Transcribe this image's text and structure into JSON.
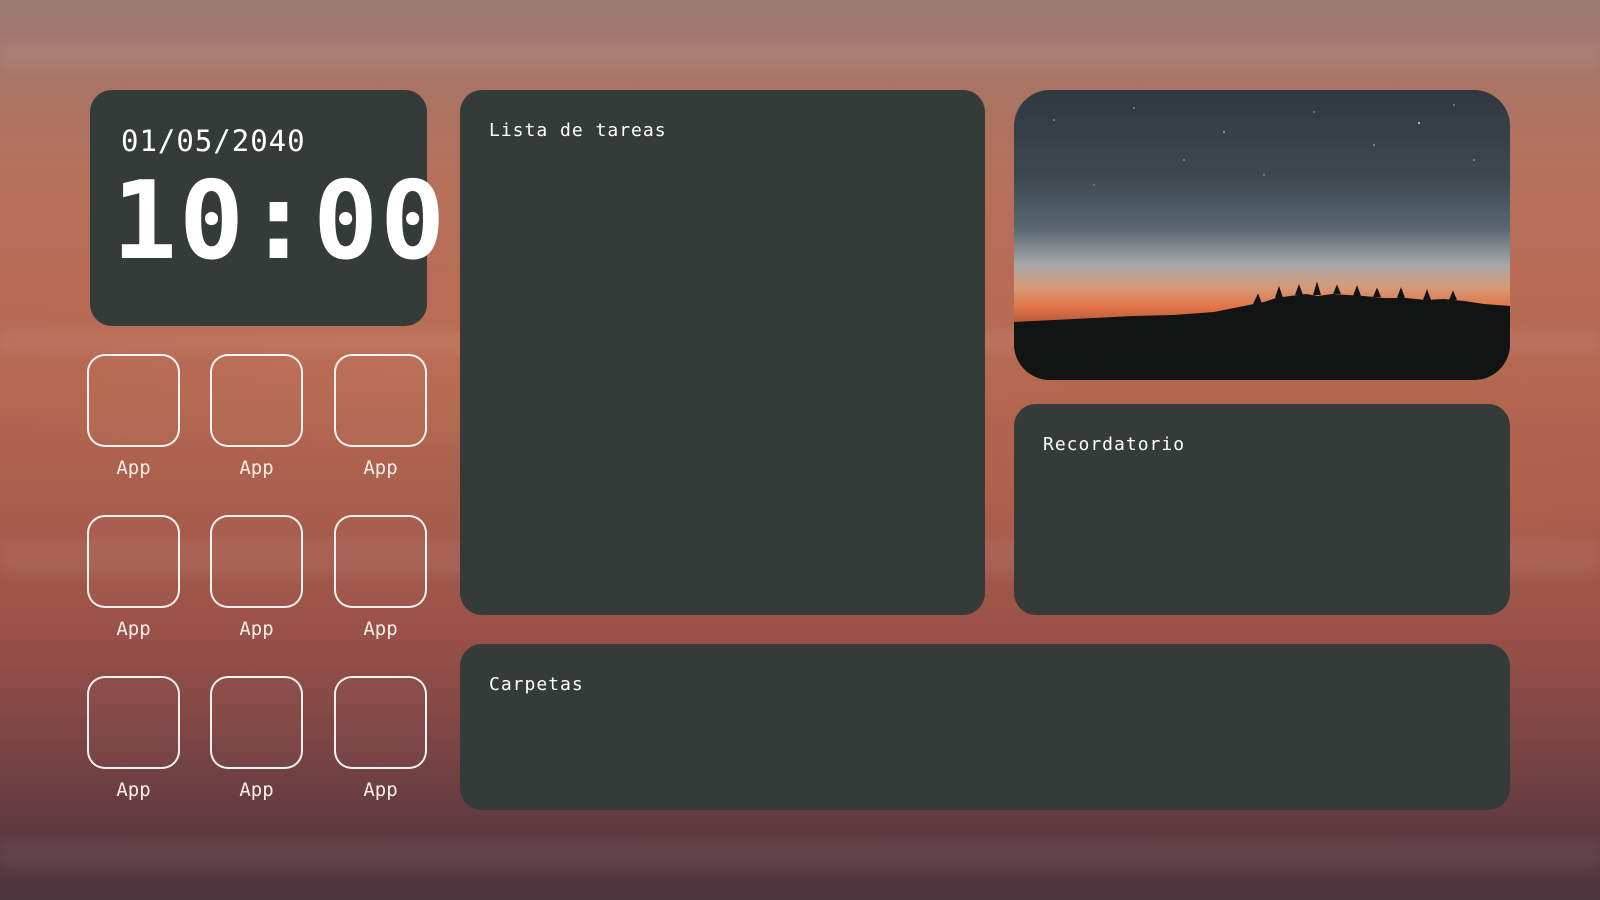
{
  "clock": {
    "date": "01/05/2040",
    "time": "10:00"
  },
  "apps": [
    {
      "label": "App"
    },
    {
      "label": "App"
    },
    {
      "label": "App"
    },
    {
      "label": "App"
    },
    {
      "label": "App"
    },
    {
      "label": "App"
    },
    {
      "label": "App"
    },
    {
      "label": "App"
    },
    {
      "label": "App"
    }
  ],
  "tasks": {
    "title": "Lista de tareas"
  },
  "reminder": {
    "title": "Recordatorio"
  },
  "folders": {
    "title": "Carpetas"
  },
  "photo": {
    "icon": "sunset-landscape-image"
  },
  "colors": {
    "panel": "#353b39",
    "text": "#ffffff",
    "background_top": "#9b7a76",
    "background_bottom": "#4e343d"
  }
}
